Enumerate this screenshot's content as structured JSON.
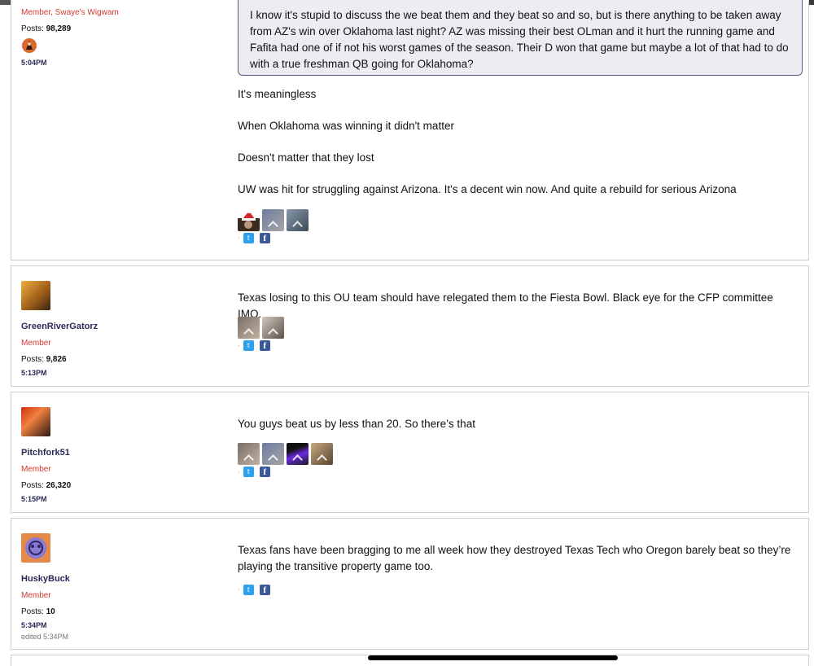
{
  "posts": [
    {
      "role": "Member, Swaye's Wigwam",
      "posts_label": "Posts:",
      "posts_count": "98,289",
      "time": "5:04PM",
      "quote": "I know it's stupid to discuss the we beat them and they beat so and so, but is there anything to be taken away from AZ's win over Oklahoma last night? AZ was missing their best OLman and it hurt the running game and Fafita had one of if not his worst games of the season. Their D won that game but maybe a lot of that had to do with a true freshman QB going for Oklahoma?",
      "paragraphs": [
        "It's meaningless",
        "When Oklahoma was winning it didn't matter",
        "Doesn't matter that they lost",
        "UW was hit for struggling against Arizona. It's a decent win now. And quite a rebuild for serious Arizona"
      ]
    },
    {
      "username": "GreenRiverGatorz",
      "role": "Member",
      "posts_label": "Posts:",
      "posts_count": "9,826",
      "time": "5:13PM",
      "body": "Texas losing to this OU team should have relegated them to the Fiesta Bowl. Black eye for the CFP committee IMO."
    },
    {
      "username": "Pitchfork51",
      "role": "Member",
      "posts_label": "Posts:",
      "posts_count": "26,320",
      "time": "5:15PM",
      "body": "You guys beat us by less than 20. So there’s that"
    },
    {
      "username": "HuskyBuck",
      "role": "Member",
      "posts_label": "Posts:",
      "posts_count": "10",
      "time": "5:34PM",
      "edited": "edited 5:34PM",
      "body": "Texas fans have been bragging to me all week how they destroyed Texas Tech who Oregon barely beat so they’re playing the transitive property game too."
    }
  ],
  "share": {
    "twitter_icon": "twitter-icon",
    "facebook_icon": "facebook-icon",
    "twitter_glyph": "t",
    "facebook_glyph": "f"
  },
  "colors": {
    "username": "#2a2a58",
    "role": "#d23a2e",
    "quote_bg": "#ecedf3",
    "quote_border": "#5a5a88",
    "twitter": "#2fa0f0",
    "facebook": "#3b5998"
  }
}
